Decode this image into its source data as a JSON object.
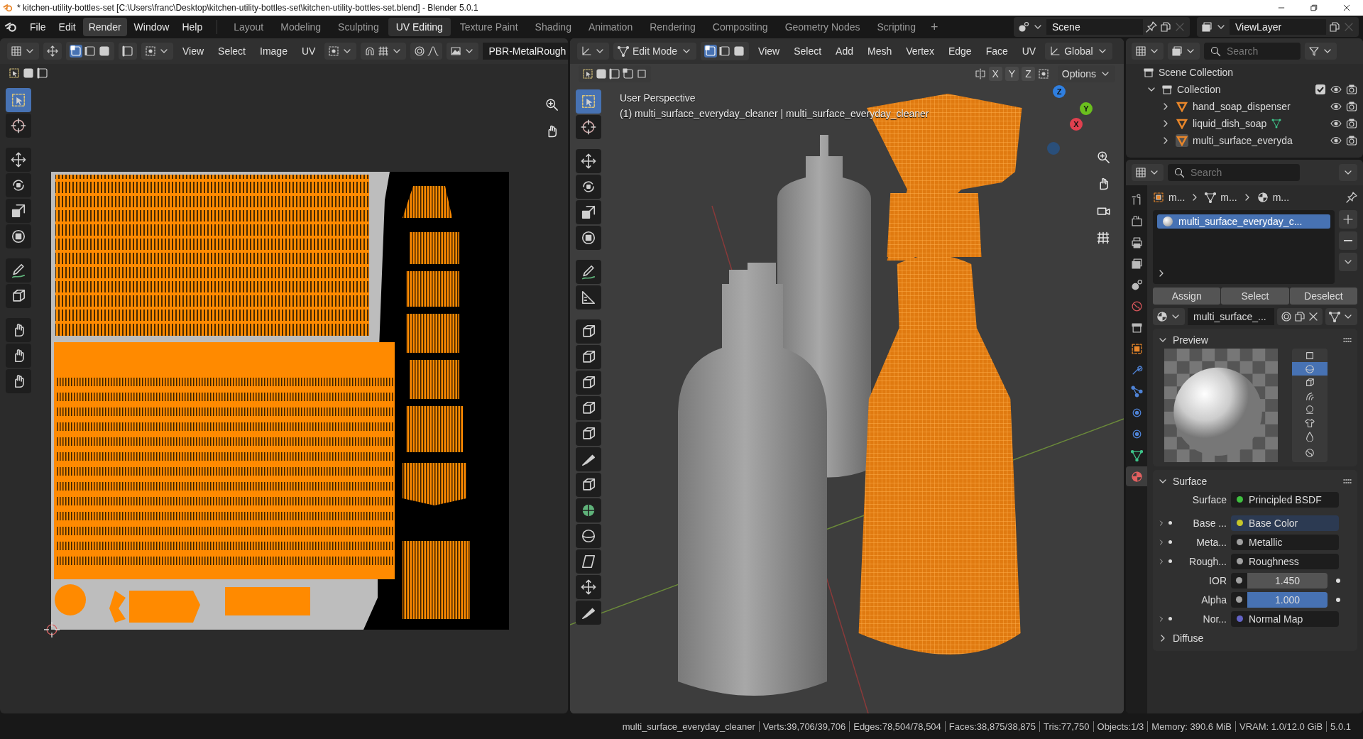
{
  "window": {
    "title": "* kitchen-utility-bottles-set [C:\\Users\\franc\\Desktop\\kitchen-utility-bottles-set\\kitchen-utility-bottles-set.blend] - Blender 5.0.1"
  },
  "menu": [
    {
      "label": "File",
      "hovered": false
    },
    {
      "label": "Edit",
      "hovered": false
    },
    {
      "label": "Render",
      "hovered": true
    },
    {
      "label": "Window",
      "hovered": false
    },
    {
      "label": "Help",
      "hovered": false
    }
  ],
  "workspaces": [
    {
      "label": "Layout",
      "selected": false
    },
    {
      "label": "Modeling",
      "selected": false
    },
    {
      "label": "Sculpting",
      "selected": false
    },
    {
      "label": "UV Editing",
      "selected": true
    },
    {
      "label": "Texture Paint",
      "selected": false
    },
    {
      "label": "Shading",
      "selected": false
    },
    {
      "label": "Animation",
      "selected": false
    },
    {
      "label": "Rendering",
      "selected": false
    },
    {
      "label": "Compositing",
      "selected": false
    },
    {
      "label": "Geometry Nodes",
      "selected": false
    },
    {
      "label": "Scripting",
      "selected": false
    }
  ],
  "add_workspace": "+",
  "scene": {
    "name": "Scene"
  },
  "view_layer": {
    "name": "ViewLayer"
  },
  "uv_editor": {
    "select_modes": [
      {
        "selected": true
      },
      {
        "selected": false
      },
      {
        "selected": false
      }
    ],
    "menus": [
      "View",
      "Select",
      "Image",
      "UV"
    ],
    "image": "PBR-MetalRough",
    "tools": [
      {
        "selected": true
      },
      {
        "selected": false
      },
      {
        "selected": false
      },
      {
        "selected": false
      },
      {
        "selected": false
      },
      {
        "selected": false
      },
      {
        "selected": false
      },
      {
        "selected": false
      },
      {
        "selected": false
      },
      {
        "selected": false
      },
      {
        "selected": false
      }
    ]
  },
  "viewport": {
    "mode": "Edit Mode",
    "select_modes": [
      {
        "selected": true
      },
      {
        "selected": false
      },
      {
        "selected": false
      }
    ],
    "menus": [
      "View",
      "Select",
      "Add",
      "Mesh",
      "Vertex",
      "Edge",
      "Face",
      "UV"
    ],
    "orientation": "Global",
    "mirror_axes": [
      "X",
      "Y",
      "Z"
    ],
    "options": "Options",
    "perspective": "User Perspective",
    "object_info": "(1) multi_surface_everyday_cleaner | multi_surface_everyday_cleaner",
    "gizmo_axes": [
      "Z",
      "Y",
      "X"
    ],
    "tools": [
      {
        "selected": true
      },
      {
        "selected": false
      },
      {
        "selected": false
      },
      {
        "selected": false
      },
      {
        "selected": false
      },
      {
        "selected": false
      },
      {
        "selected": false
      },
      {
        "selected": false
      },
      {
        "selected": false
      },
      {
        "selected": false
      },
      {
        "selected": false
      },
      {
        "selected": false
      },
      {
        "selected": false
      },
      {
        "selected": false
      },
      {
        "selected": false
      },
      {
        "selected": false
      },
      {
        "selected": false
      },
      {
        "selected": false
      },
      {
        "selected": false
      },
      {
        "selected": false
      }
    ]
  },
  "outliner": {
    "search_placeholder": "Search",
    "scene_collection": "Scene Collection",
    "collection": {
      "name": "Collection",
      "checked": true
    },
    "objects": [
      {
        "name": "hand_soap_dispenser",
        "active": false,
        "mesh_data": false
      },
      {
        "name": "liquid_dish_soap",
        "active": false,
        "mesh_data": true
      },
      {
        "name": "multi_surface_everyda",
        "active": true,
        "mesh_data": false
      }
    ]
  },
  "properties": {
    "search_placeholder": "Search",
    "tabs": [
      {
        "selected": false
      },
      {
        "selected": false
      },
      {
        "selected": false
      },
      {
        "selected": false
      },
      {
        "selected": false
      },
      {
        "selected": false
      },
      {
        "selected": false
      },
      {
        "selected": false
      },
      {
        "selected": false
      },
      {
        "selected": false
      },
      {
        "selected": false
      },
      {
        "selected": false
      },
      {
        "selected": false
      },
      {
        "selected": true
      }
    ],
    "breadcrumb": [
      "m...",
      "m...",
      "m..."
    ],
    "slots": [
      {
        "name": "multi_surface_everyday_c...",
        "selected": true
      }
    ],
    "buttons": [
      "Assign",
      "Select",
      "Deselect"
    ],
    "material": "multi_surface_...",
    "preview": {
      "title": "Preview",
      "shapes": [
        {
          "selected": false
        },
        {
          "selected": true
        },
        {
          "selected": false
        },
        {
          "selected": false
        },
        {
          "selected": false
        },
        {
          "selected": false
        },
        {
          "selected": false
        }
      ]
    },
    "surface": {
      "title": "Surface",
      "rows": [
        {
          "kind": "shader",
          "label": "Surface",
          "value": "Principled BSDF",
          "color": "#3fbf3f",
          "hovered": false
        },
        {
          "kind": "link",
          "label": "Base ...",
          "value": "Base Color",
          "color": "#c7c729",
          "hovered": true
        },
        {
          "kind": "link",
          "label": "Meta...",
          "value": "Metallic",
          "color": "#a1a1a1",
          "hovered": false
        },
        {
          "kind": "link",
          "label": "Rough...",
          "value": "Roughness",
          "color": "#a1a1a1",
          "hovered": false
        },
        {
          "kind": "number",
          "label": "IOR",
          "value": "1.450",
          "color": "#a1a1a1"
        },
        {
          "kind": "factor",
          "label": "Alpha",
          "value": "1.000",
          "level": 1,
          "color": "#a1a1a1"
        },
        {
          "kind": "link",
          "label": "Nor...",
          "value": "Normal Map",
          "color": "#6363c7",
          "hovered": false
        }
      ]
    },
    "diffuse": "Diffuse"
  },
  "status_bar": [
    "multi_surface_everyday_cleaner",
    "Verts:39,706/39,706",
    "Edges:78,504/78,504",
    "Faces:38,875/38,875",
    "Tris:77,750",
    "Objects:1/3",
    "Memory: 390.6 MiB",
    "VRAM: 1.0/12.0 GiB",
    "5.0.1"
  ]
}
